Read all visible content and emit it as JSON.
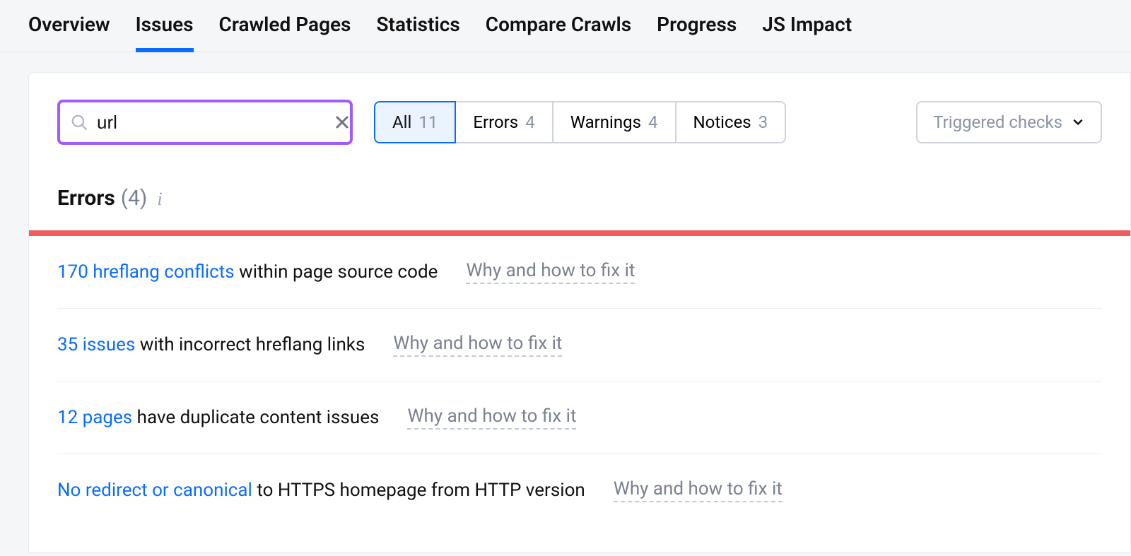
{
  "nav": {
    "tabs": [
      {
        "label": "Overview",
        "active": false
      },
      {
        "label": "Issues",
        "active": true
      },
      {
        "label": "Crawled Pages",
        "active": false
      },
      {
        "label": "Statistics",
        "active": false
      },
      {
        "label": "Compare Crawls",
        "active": false
      },
      {
        "label": "Progress",
        "active": false
      },
      {
        "label": "JS Impact",
        "active": false
      }
    ]
  },
  "search": {
    "value": "url"
  },
  "filters": {
    "items": [
      {
        "label": "All",
        "count": "11",
        "active": true
      },
      {
        "label": "Errors",
        "count": "4",
        "active": false
      },
      {
        "label": "Warnings",
        "count": "4",
        "active": false
      },
      {
        "label": "Notices",
        "count": "3",
        "active": false
      }
    ]
  },
  "triggered_label": "Triggered checks",
  "errors_section": {
    "title": "Errors",
    "count": "(4)"
  },
  "issues": [
    {
      "link": "170 hreflang conflicts",
      "text": " within page source code",
      "fix": "Why and how to fix it"
    },
    {
      "link": "35 issues",
      "text": " with incorrect hreflang links",
      "fix": "Why and how to fix it"
    },
    {
      "link": "12 pages",
      "text": " have duplicate content issues",
      "fix": "Why and how to fix it"
    },
    {
      "link": "No redirect or canonical",
      "text": " to HTTPS homepage from HTTP version",
      "fix": "Why and how to fix it"
    }
  ]
}
